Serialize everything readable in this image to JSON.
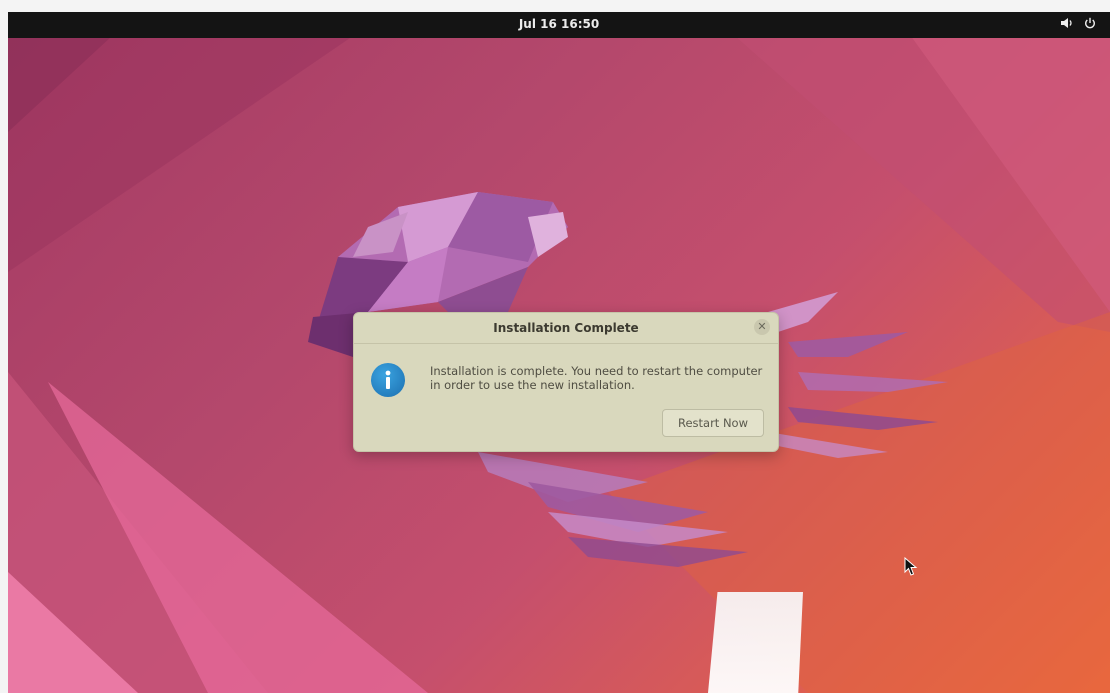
{
  "topbar": {
    "clock": "Jul 16  16:50",
    "icons": [
      "volume-icon",
      "power-icon"
    ]
  },
  "dialog": {
    "title": "Installation Complete",
    "close_icon": "close-icon",
    "info_icon": "info-icon",
    "message": "Installation is complete. You need to restart the computer in order to use the new installation.",
    "restart_label": "Restart Now"
  },
  "colors": {
    "topbar": "#141414",
    "dialog_bg": "#d9d8bd",
    "info_blue": "#2a8fd1",
    "wallpaper_main": "#b4486c",
    "wallpaper_accent": "#ef6b3e"
  }
}
